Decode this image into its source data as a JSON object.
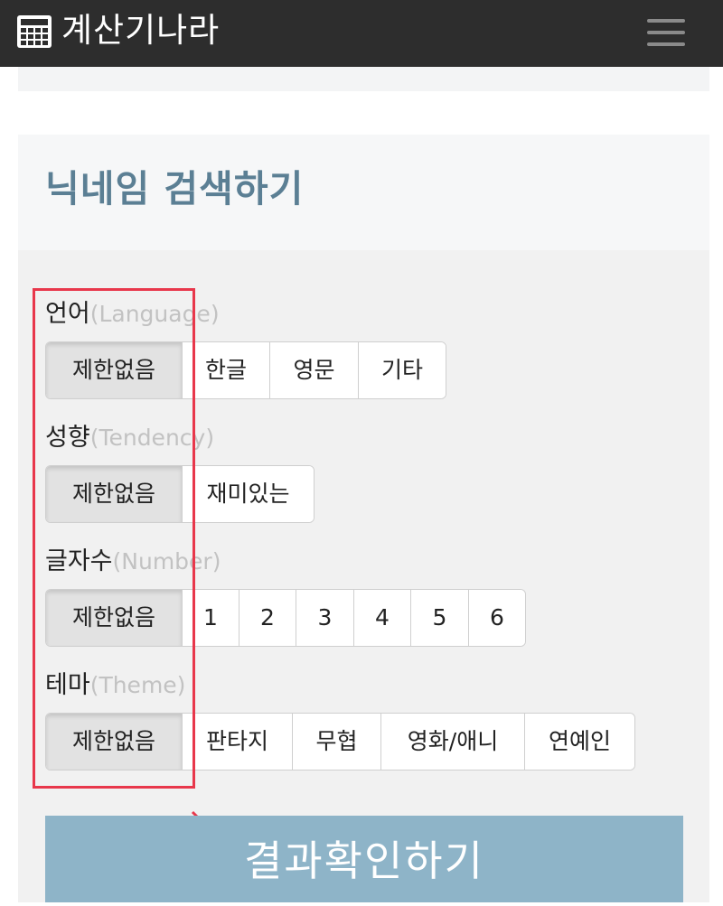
{
  "header": {
    "app_title": "계산기나라",
    "logo_icon": "calculator-icon",
    "menu_icon": "hamburger-menu-icon"
  },
  "card": {
    "title": "닉네임 검색하기"
  },
  "filters": {
    "language": {
      "label": "언어",
      "label_en": "(Language)",
      "options": [
        "제한없음",
        "한글",
        "영문",
        "기타"
      ],
      "selected": "제한없음"
    },
    "tendency": {
      "label": "성향",
      "label_en": "(Tendency)",
      "options": [
        "제한없음",
        "재미있는"
      ],
      "selected": "제한없음"
    },
    "number": {
      "label": "글자수",
      "label_en": "(Number)",
      "options": [
        "제한없음",
        "1",
        "2",
        "3",
        "4",
        "5",
        "6"
      ],
      "selected": "제한없음"
    },
    "theme": {
      "label": "테마",
      "label_en": "(Theme)",
      "options": [
        "제한없음",
        "판타지",
        "무협",
        "영화/애니",
        "연예인"
      ],
      "selected": "제한없음"
    }
  },
  "submit": {
    "label": "결과확인하기"
  },
  "colors": {
    "topbar": "#2d2d2d",
    "title_accent": "#5b7f94",
    "submit_button": "#8eb4c8",
    "annotation": "#e8374b",
    "selected_option": "#e2e2e2"
  }
}
